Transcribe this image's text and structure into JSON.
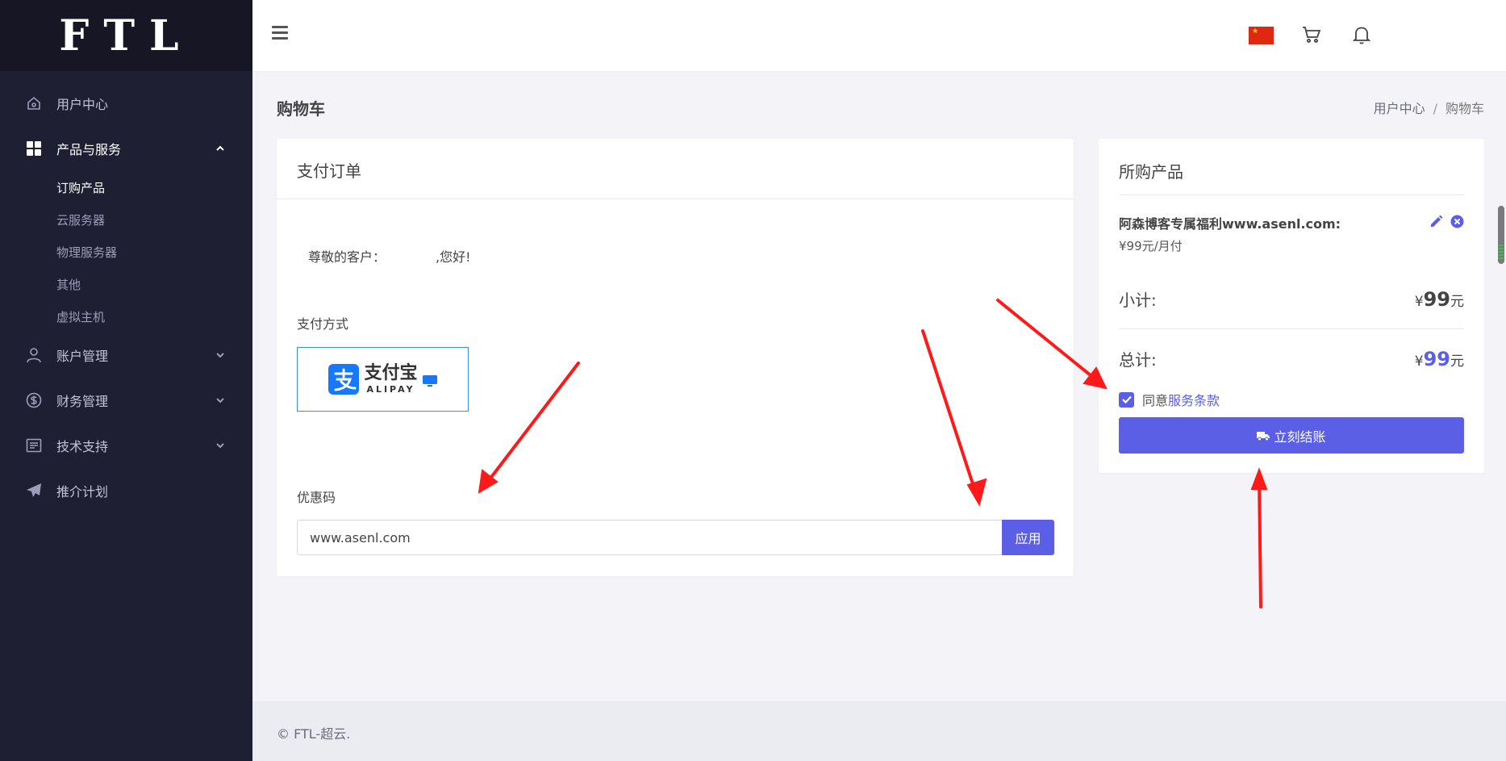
{
  "brand": {
    "logo_text": "FTL"
  },
  "sidebar": {
    "items": [
      {
        "label": "用户中心",
        "icon": "home-icon"
      },
      {
        "label": "产品与服务",
        "icon": "grid-icon",
        "expanded": true,
        "children": [
          "订购产品",
          "云服务器",
          "物理服务器",
          "其他",
          "虚拟主机"
        ]
      },
      {
        "label": "账户管理",
        "icon": "user-icon"
      },
      {
        "label": "财务管理",
        "icon": "dollar-icon"
      },
      {
        "label": "技术支持",
        "icon": "document-icon"
      },
      {
        "label": "推介计划",
        "icon": "paper-plane-icon"
      }
    ],
    "active_child": "订购产品"
  },
  "header": {
    "icons": [
      "menu-icon",
      "china-flag-icon",
      "cart-icon",
      "bell-icon"
    ]
  },
  "page": {
    "title": "购物车",
    "breadcrumb": {
      "home": "用户中心",
      "separator": "/",
      "current": "购物车"
    }
  },
  "order": {
    "title": "支付订单",
    "greeting_prefix": "尊敬的客户：",
    "greeting_suffix": ",您好!",
    "payment_label": "支付方式",
    "alipay": {
      "brand_cn": "支付宝",
      "brand_en": "ALIPAY"
    },
    "coupon_label": "优惠码",
    "coupon_value": "www.asenl.com",
    "apply_label": "应用"
  },
  "summary": {
    "title": "所购产品",
    "product_name": "阿森博客专属福利www.asenl.com:",
    "product_price": "¥99元/月付",
    "subtotal_label": "小计:",
    "subtotal_currency": "¥",
    "subtotal_value": "99",
    "subtotal_unit": "元",
    "total_label": "总计:",
    "total_currency": "¥",
    "total_value": "99",
    "total_unit": "元",
    "agree_prefix": "同意",
    "terms_link": "服务条款",
    "agree_checked": true,
    "checkout_label": "立刻结账"
  },
  "footer": {
    "text": "© FTL-超云."
  },
  "colors": {
    "accent": "#5b5fe6",
    "sidebar_bg": "#1f1f33",
    "annotation_arrow": "#ff1a1a"
  }
}
